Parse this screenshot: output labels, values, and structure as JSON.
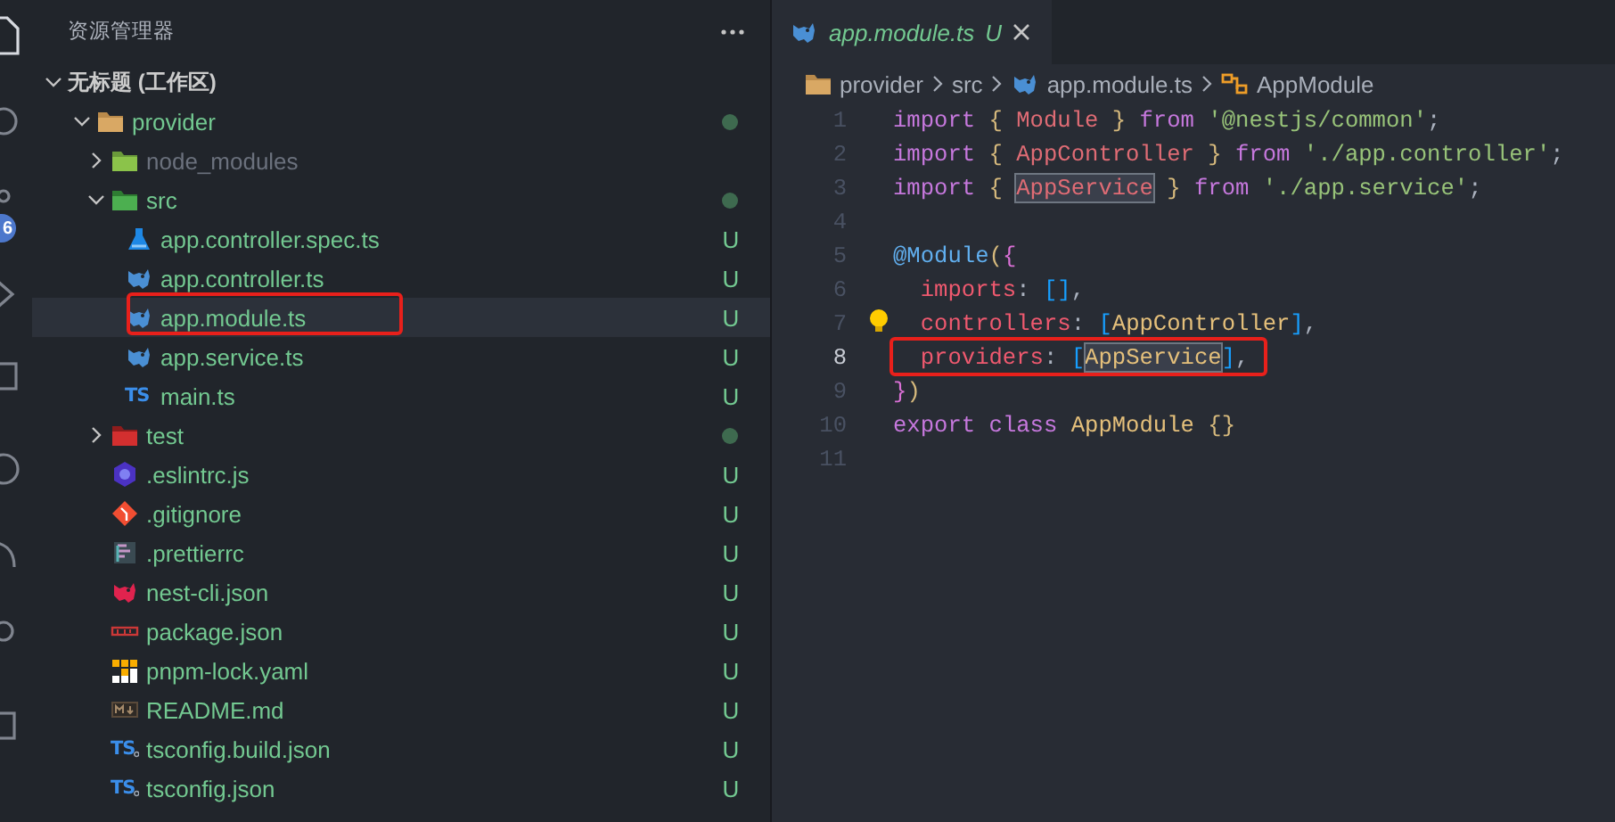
{
  "activity_bar": {
    "badge": "6"
  },
  "sidebar": {
    "title": "资源管理器",
    "workspace": {
      "label": "无标题 (工作区)",
      "expanded": true
    },
    "tree": [
      {
        "name": "provider",
        "kind": "folder",
        "expanded": true,
        "modified_dot": true,
        "selected": false,
        "children": [
          {
            "name": "node_modules",
            "kind": "folder-npm",
            "expanded": false,
            "ignored": true,
            "selected": false
          },
          {
            "name": "src",
            "kind": "folder-src",
            "expanded": true,
            "modified_dot": true,
            "selected": false,
            "children": [
              {
                "name": "app.controller.spec.ts",
                "kind": "spec",
                "status": "U",
                "selected": false
              },
              {
                "name": "app.controller.ts",
                "kind": "nest",
                "status": "U",
                "selected": false
              },
              {
                "name": "app.module.ts",
                "kind": "nest",
                "status": "U",
                "selected": true,
                "outlined": true
              },
              {
                "name": "app.service.ts",
                "kind": "nest",
                "status": "U",
                "selected": false
              },
              {
                "name": "main.ts",
                "kind": "ts",
                "icon_text": "TS",
                "status": "U",
                "selected": false
              }
            ]
          },
          {
            "name": "test",
            "kind": "folder-test",
            "expanded": false,
            "modified_dot": true,
            "selected": false
          },
          {
            "name": ".eslintrc.js",
            "kind": "eslint",
            "status": "U",
            "selected": false
          },
          {
            "name": ".gitignore",
            "kind": "git",
            "status": "U",
            "selected": false
          },
          {
            "name": ".prettierrc",
            "kind": "prettier",
            "status": "U",
            "selected": false
          },
          {
            "name": "nest-cli.json",
            "kind": "nest-red",
            "status": "U",
            "selected": false
          },
          {
            "name": "package.json",
            "kind": "npm",
            "status": "U",
            "selected": false
          },
          {
            "name": "pnpm-lock.yaml",
            "kind": "pnpm",
            "status": "U",
            "selected": false
          },
          {
            "name": "README.md",
            "kind": "markdown",
            "status": "U",
            "selected": false
          },
          {
            "name": "tsconfig.build.json",
            "kind": "tsconfig",
            "icon_text": "TS",
            "status": "U",
            "selected": false
          },
          {
            "name": "tsconfig.json",
            "kind": "tsconfig",
            "icon_text": "TS",
            "status": "U",
            "selected": false
          }
        ]
      }
    ]
  },
  "editor": {
    "tabs": [
      {
        "label": "app.module.ts",
        "kind": "nest",
        "status": "U",
        "preview": true,
        "selected": true
      }
    ],
    "breadcrumbs": [
      {
        "label": "provider",
        "kind": "folder"
      },
      {
        "label": "src",
        "kind": "plain"
      },
      {
        "label": "app.module.ts",
        "kind": "nest"
      },
      {
        "label": "AppModule",
        "kind": "symbol"
      }
    ],
    "lines": [
      {
        "number": "1",
        "current": false,
        "tokens": [
          {
            "text": "import ",
            "kind": "keyword"
          },
          {
            "text": "{ ",
            "kind": "brace1"
          },
          {
            "text": "Module ",
            "kind": "import-name"
          },
          {
            "text": "} ",
            "kind": "brace1"
          },
          {
            "text": "from ",
            "kind": "keyword"
          },
          {
            "text": "'@nestjs/common'",
            "kind": "string"
          },
          {
            "text": ";",
            "kind": "punct"
          }
        ]
      },
      {
        "number": "2",
        "current": false,
        "tokens": [
          {
            "text": "import ",
            "kind": "keyword"
          },
          {
            "text": "{ ",
            "kind": "brace1"
          },
          {
            "text": "AppController ",
            "kind": "import-name"
          },
          {
            "text": "} ",
            "kind": "brace1"
          },
          {
            "text": "from ",
            "kind": "keyword"
          },
          {
            "text": "'./app.controller'",
            "kind": "string"
          },
          {
            "text": ";",
            "kind": "punct"
          }
        ]
      },
      {
        "number": "3",
        "current": false,
        "tokens": [
          {
            "text": "import ",
            "kind": "keyword"
          },
          {
            "text": "{ ",
            "kind": "brace1"
          },
          {
            "text": "AppService",
            "kind": "import-name-match"
          },
          {
            "text": " } ",
            "kind": "brace1"
          },
          {
            "text": "from ",
            "kind": "keyword"
          },
          {
            "text": "'./app.service'",
            "kind": "string"
          },
          {
            "text": ";",
            "kind": "punct"
          }
        ]
      },
      {
        "number": "4",
        "current": false
      },
      {
        "number": "5",
        "current": false,
        "tokens": [
          {
            "text": "@Module",
            "kind": "decorator"
          },
          {
            "text": "(",
            "kind": "brace1"
          },
          {
            "text": "{",
            "kind": "brace2"
          }
        ]
      },
      {
        "number": "6",
        "current": false,
        "tokens": [
          {
            "text": "  imports",
            "kind": "property"
          },
          {
            "text": ": ",
            "kind": "punct"
          },
          {
            "text": "[]",
            "kind": "brace3"
          },
          {
            "text": ",",
            "kind": "punct"
          }
        ]
      },
      {
        "number": "7",
        "current": false,
        "lightbulb": true,
        "tokens": [
          {
            "text": "  controllers",
            "kind": "property"
          },
          {
            "text": ": ",
            "kind": "punct"
          },
          {
            "text": "[",
            "kind": "brace3"
          },
          {
            "text": "AppController",
            "kind": "class"
          },
          {
            "text": "]",
            "kind": "brace3"
          },
          {
            "text": ",",
            "kind": "punct"
          }
        ]
      },
      {
        "number": "8",
        "current": true,
        "outlined": true,
        "tokens": [
          {
            "text": "  providers",
            "kind": "property"
          },
          {
            "text": ": ",
            "kind": "punct"
          },
          {
            "text": "[",
            "kind": "brace3"
          },
          {
            "text": "AppService",
            "kind": "class-match"
          },
          {
            "text": "]",
            "kind": "brace3"
          },
          {
            "text": ",",
            "kind": "punct"
          }
        ]
      },
      {
        "number": "9",
        "current": false,
        "tokens": [
          {
            "text": "}",
            "kind": "brace2"
          },
          {
            "text": ")",
            "kind": "brace1"
          }
        ]
      },
      {
        "number": "10",
        "current": false,
        "tokens": [
          {
            "text": "export ",
            "kind": "keyword"
          },
          {
            "text": "class ",
            "kind": "keyword"
          },
          {
            "text": "AppModule ",
            "kind": "class"
          },
          {
            "text": "{}",
            "kind": "brace1"
          }
        ]
      },
      {
        "number": "11",
        "current": false
      }
    ]
  }
}
